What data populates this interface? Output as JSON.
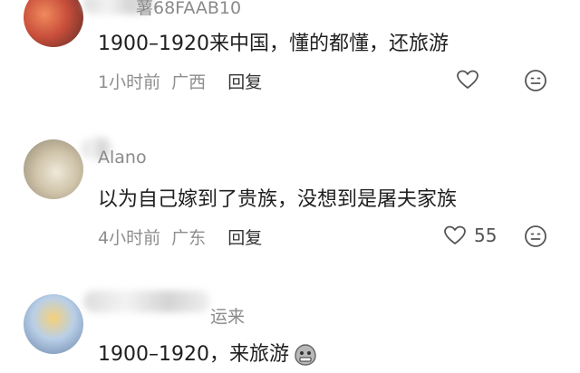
{
  "comments": [
    {
      "username": "薯68FAAB10",
      "text": "1900–1920来中国，懂的都懂，还旅游",
      "time": "1小时前",
      "location": "广西",
      "reply_label": "回复",
      "likes": ""
    },
    {
      "username": "Alano",
      "text": "以为自己嫁到了贵族，没想到是屠夫家族",
      "time": "4小时前",
      "location": "广东",
      "reply_label": "回复",
      "likes": "55"
    },
    {
      "username": "运来",
      "text": "1900–1920，来旅游",
      "time": "",
      "location": "",
      "reply_label": "",
      "likes": ""
    }
  ],
  "icons": {
    "like": "heart-outline-icon",
    "more": "neutral-face-icon",
    "emoji": "grimace-sticker-icon"
  }
}
